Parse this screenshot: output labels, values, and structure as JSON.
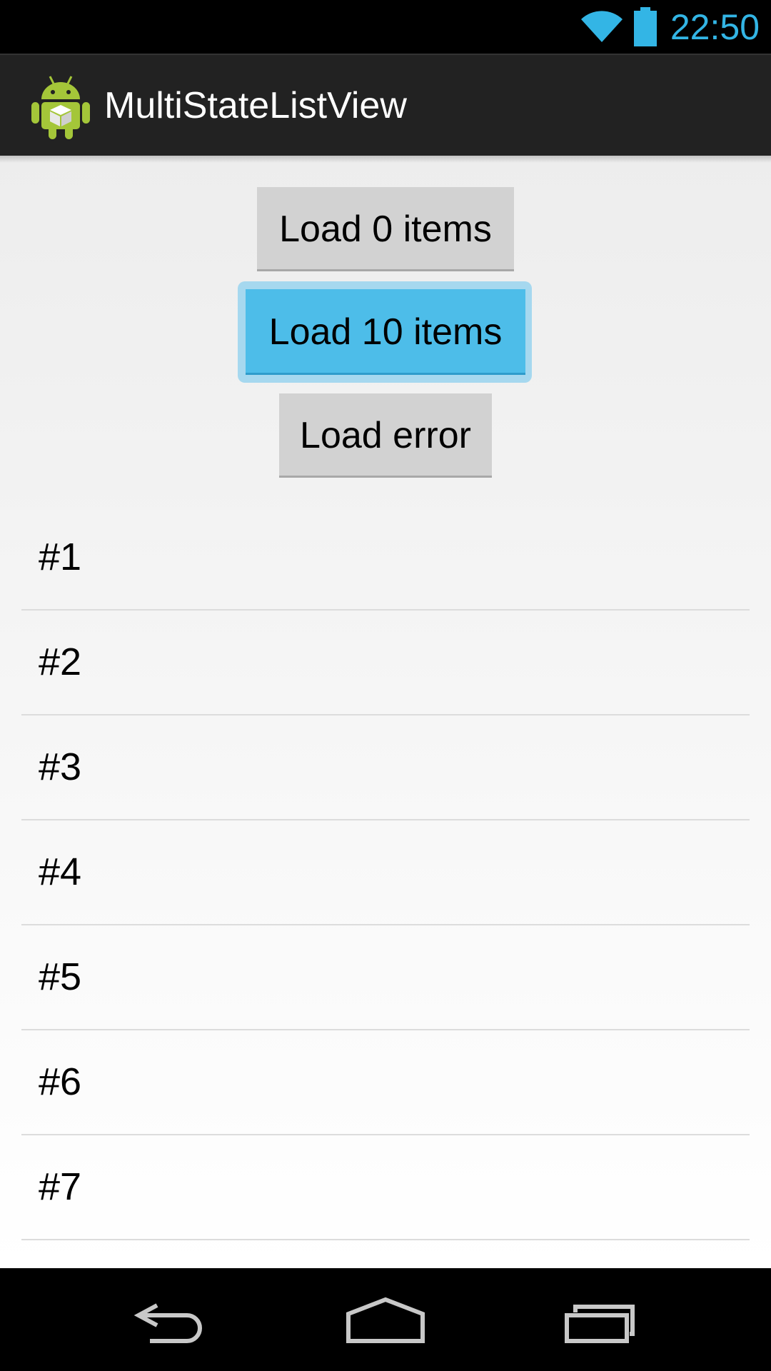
{
  "status_bar": {
    "time": "22:50",
    "icons": [
      "wifi-icon",
      "battery-icon"
    ],
    "accent_color": "#33b5e5"
  },
  "action_bar": {
    "title": "MultiStateListView",
    "icon": "android-app-icon"
  },
  "buttons": {
    "load_zero": "Load 0 items",
    "load_ten": "Load 10 items",
    "load_error": "Load error",
    "focused_color": "#4dbde9"
  },
  "list": {
    "items": [
      "#1",
      "#2",
      "#3",
      "#4",
      "#5",
      "#6",
      "#7"
    ]
  },
  "nav_bar": {
    "icons": [
      "back-icon",
      "home-icon",
      "recents-icon"
    ]
  }
}
